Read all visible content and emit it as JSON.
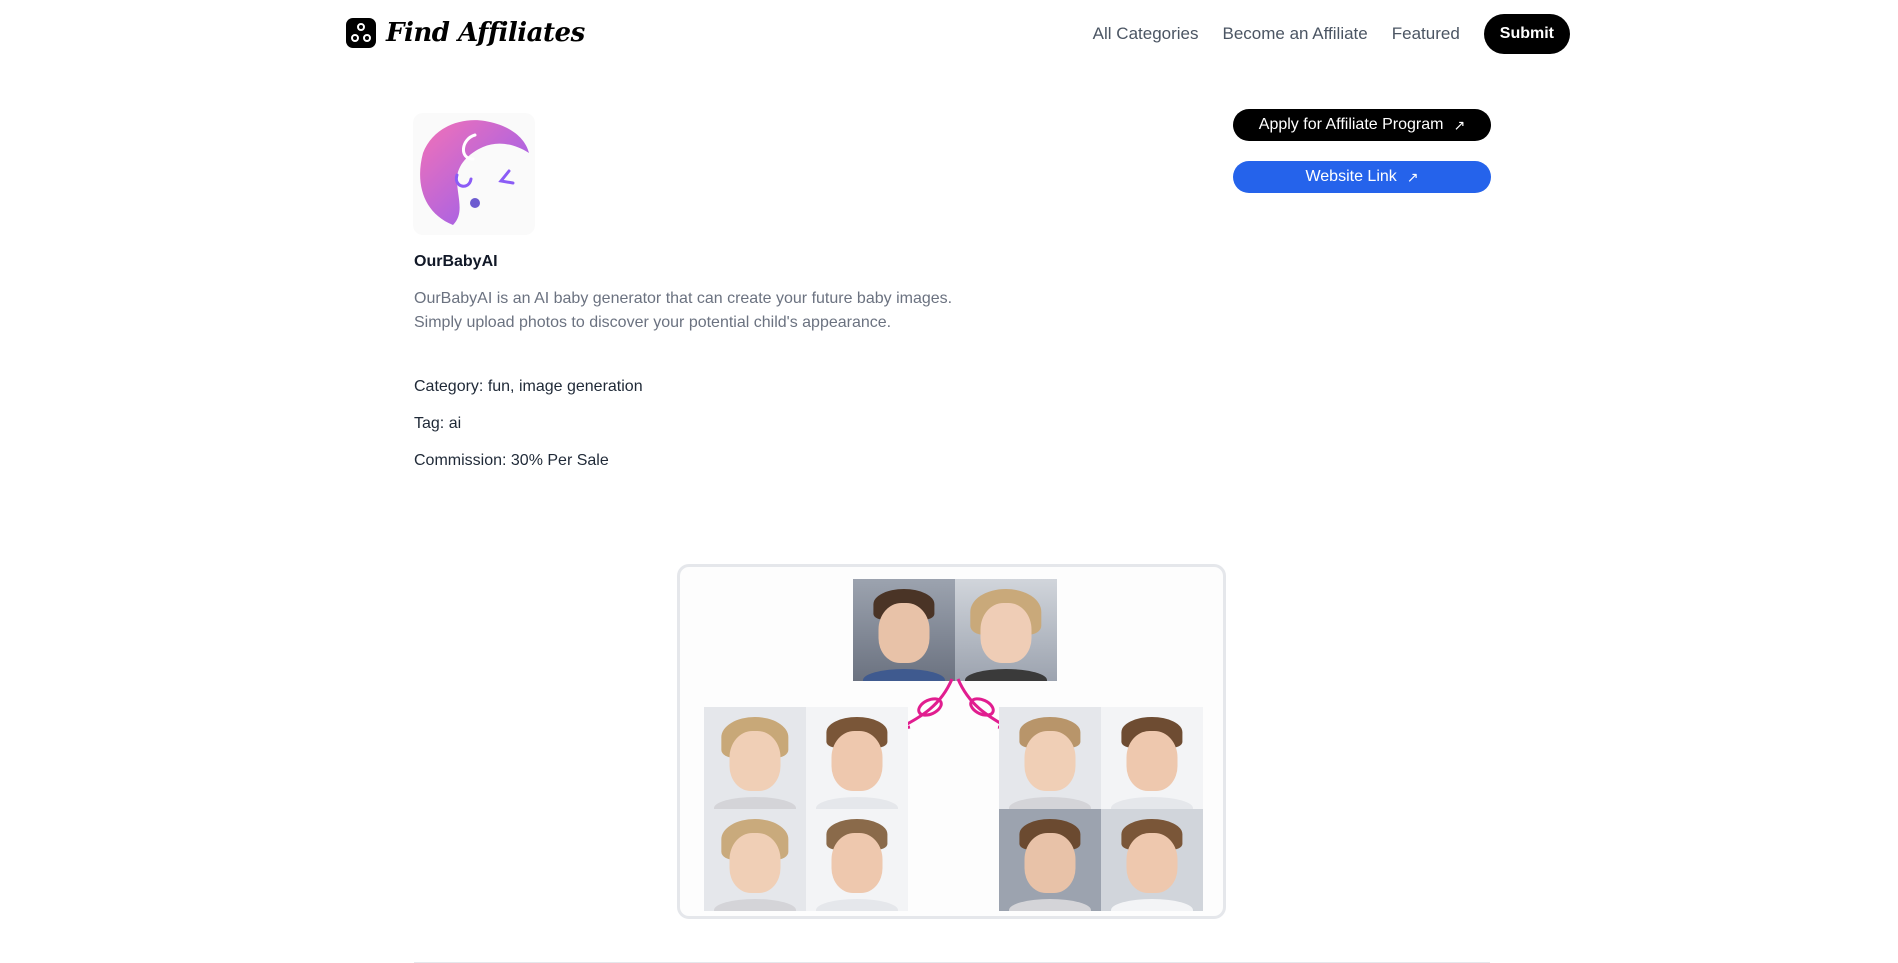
{
  "header": {
    "brand": "Find Affiliates",
    "nav": [
      {
        "label": "All Categories"
      },
      {
        "label": "Become an Affiliate"
      },
      {
        "label": "Featured"
      }
    ],
    "submit_label": "Submit"
  },
  "product": {
    "name": "OurBabyAI",
    "description": "OurBabyAI is an AI baby generator that can create your future baby images. Simply upload photos to discover your potential child's appearance.",
    "category": "Category: fun, image generation",
    "tag": "Tag: ai",
    "commission": "Commission: 30% Per Sale"
  },
  "actions": {
    "apply_label": "Apply for Affiliate Program",
    "website_label": "Website Link",
    "arrow": "↗"
  },
  "colors": {
    "accent_blue": "#2563eb",
    "arrow_pink": "#e11d8f",
    "logo_gradient_start": "#f472b6",
    "logo_gradient_end": "#8b5cf6"
  }
}
